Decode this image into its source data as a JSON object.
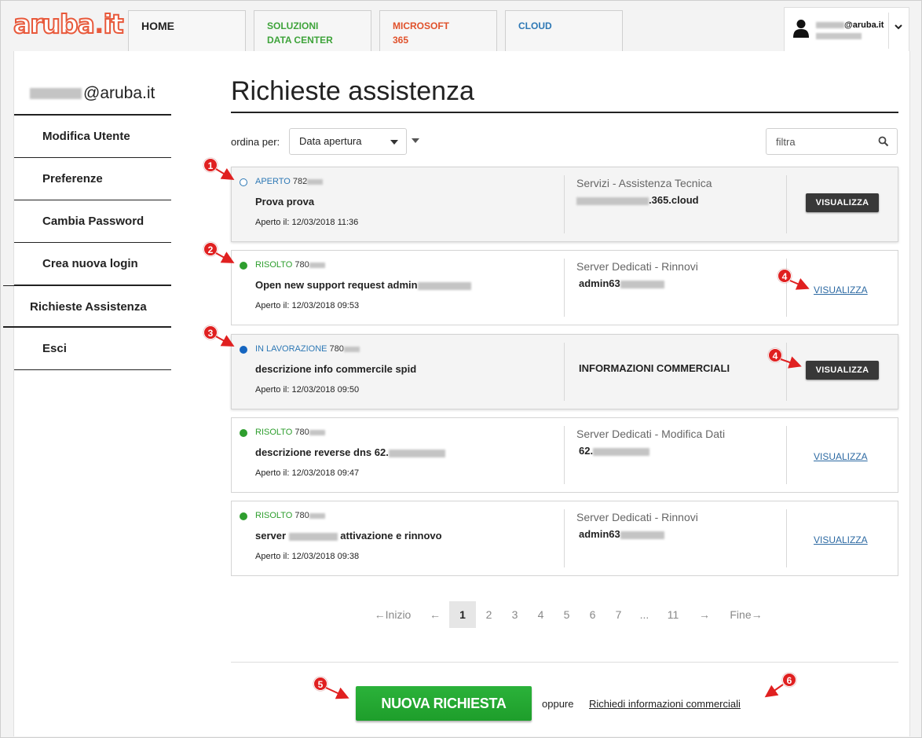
{
  "brand": {
    "logo_main": "aruba",
    "logo_dot": ".",
    "logo_tld": "it"
  },
  "topnav": {
    "tabs": [
      {
        "line1": "HOME",
        "line2": ""
      },
      {
        "line1": "SOLUZIONI",
        "line2": "DATA CENTER"
      },
      {
        "line1": "MICROSOFT",
        "line2": "365"
      },
      {
        "line1": "CLOUD",
        "line2": ""
      }
    ]
  },
  "user": {
    "email_suffix": "@aruba.it"
  },
  "sidebar": {
    "email_suffix": "@aruba.it",
    "items": [
      {
        "label": "Modifica Utente"
      },
      {
        "label": "Preferenze"
      },
      {
        "label": "Cambia Password"
      },
      {
        "label": "Crea nuova login"
      },
      {
        "label": "Richieste Assistenza"
      },
      {
        "label": "Esci"
      }
    ]
  },
  "main": {
    "title": "Richieste assistenza",
    "sort_label": "ordina per:",
    "sort_value": "Data apertura",
    "filter_placeholder": "filtra"
  },
  "colors": {
    "open": "#2d78b5",
    "resolved": "#2e9e2e",
    "in_progress": "#1565c0",
    "accent": "#e8593b",
    "primary_button": "#22a832"
  },
  "tickets": [
    {
      "status": "APERTO",
      "number": "782",
      "title": "Prova prova",
      "title_suffix": "",
      "date": "Aperto il: 12/03/2018 11:36",
      "category": "Servizi - Assistenza Tecnica",
      "service": ".365.cloud",
      "action": "VISUALIZZA"
    },
    {
      "status": "RISOLTO",
      "number": "780",
      "title": "Open new support request admin",
      "title_suffix": "",
      "date": "Aperto il: 12/03/2018 09:53",
      "category": "Server Dedicati - Rinnovi",
      "service": "admin63",
      "action": "VISUALIZZA"
    },
    {
      "status": "IN LAVORAZIONE",
      "number": "780",
      "title": "descrizione info commercile spid",
      "title_suffix": "",
      "date": "Aperto il: 12/03/2018 09:50",
      "category": "",
      "service": "INFORMAZIONI COMMERCIALI",
      "action": "VISUALIZZA"
    },
    {
      "status": "RISOLTO",
      "number": "780",
      "title": "descrizione reverse dns 62.",
      "title_suffix": "",
      "date": "Aperto il: 12/03/2018 09:47",
      "category": "Server Dedicati - Modifica Dati",
      "service": "62.",
      "action": "VISUALIZZA"
    },
    {
      "status": "RISOLTO",
      "number": "780",
      "title": "server",
      "title_suffix": "attivazione e rinnovo",
      "date": "Aperto il: 12/03/2018 09:38",
      "category": "Server Dedicati - Rinnovi",
      "service": "admin63",
      "action": "VISUALIZZA"
    }
  ],
  "pagination": {
    "first": "←Inizio",
    "prev": "←",
    "pages": [
      "1",
      "2",
      "3",
      "4",
      "5",
      "6",
      "7",
      "...",
      "11"
    ],
    "current": "1",
    "next": "→",
    "last": "Fine→"
  },
  "footer": {
    "new_request": "NUOVA RICHIESTA",
    "or": "oppure",
    "commercial_info": "Richiedi informazioni commerciali"
  },
  "annotations": [
    "1",
    "2",
    "3",
    "4",
    "4",
    "5",
    "6"
  ],
  "icons": {
    "user": "user-silhouette-icon",
    "chevron": "chevron-down-icon",
    "search": "search-icon"
  }
}
